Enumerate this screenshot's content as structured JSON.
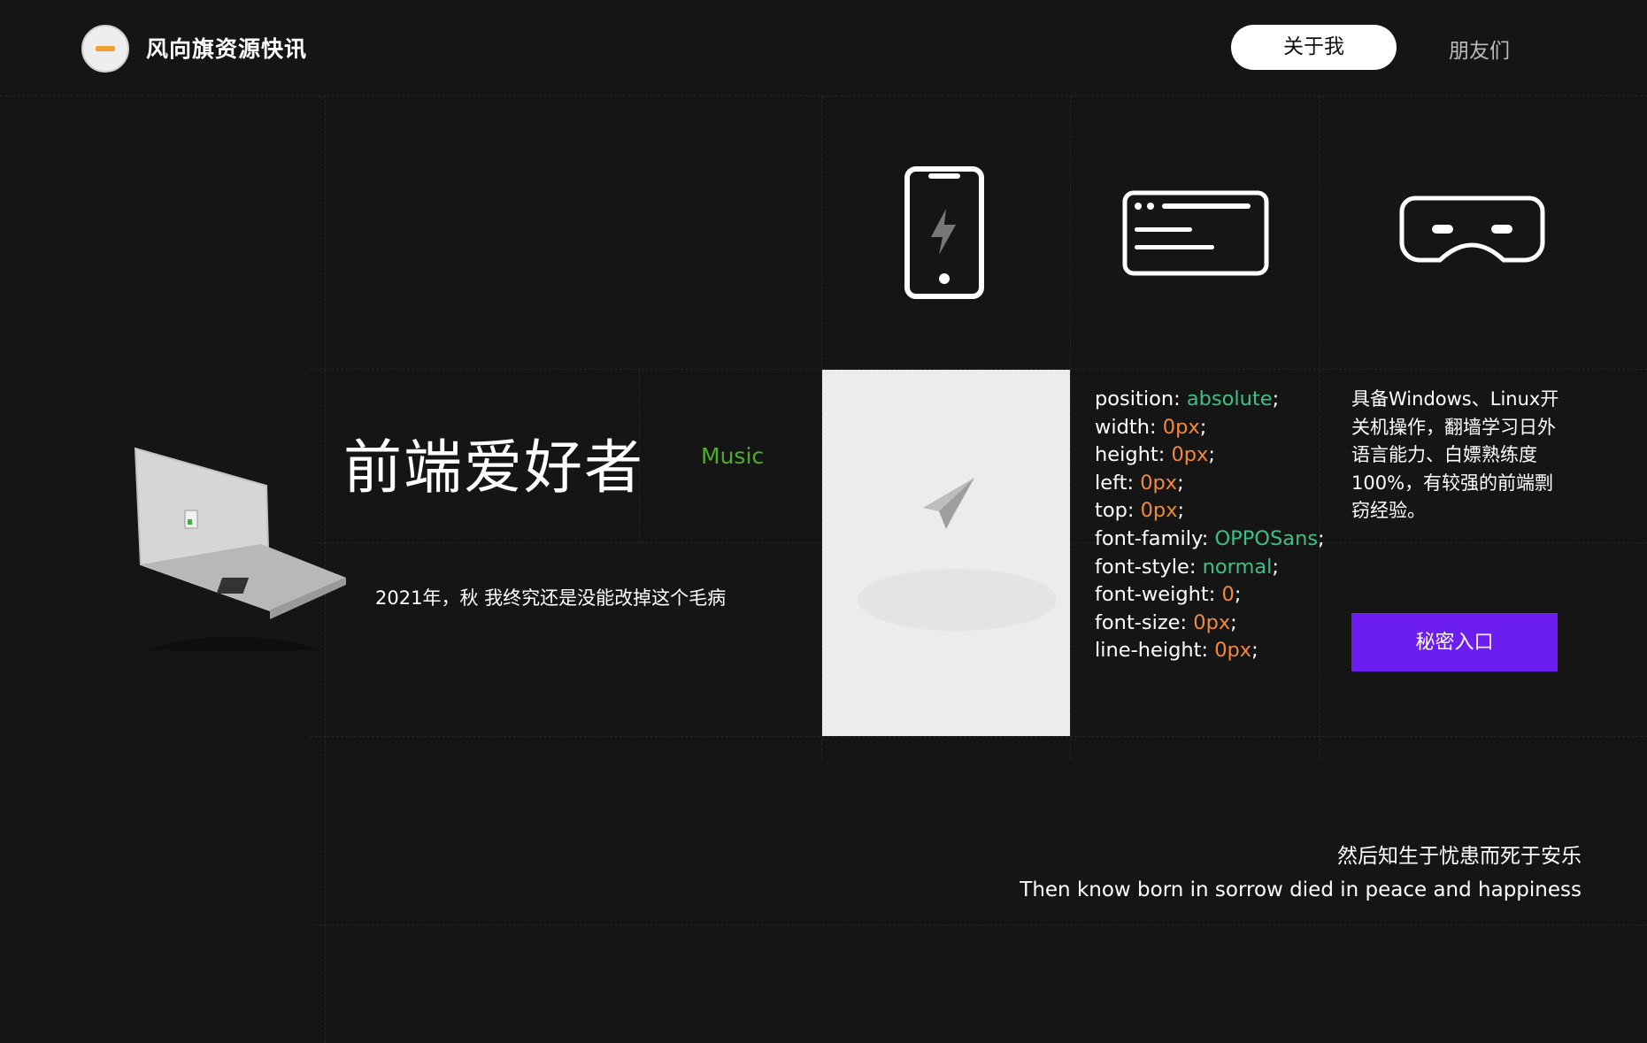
{
  "header": {
    "brand": "风向旗资源快讯",
    "nav": {
      "active": "关于我",
      "link": "朋友们"
    }
  },
  "hero": {
    "title": "前端爱好者",
    "tag": "Music",
    "subtitle": "2021年，秋 我终究还是没能改掉这个毛病"
  },
  "icons": [
    "phone-flash-icon",
    "browser-window-icon",
    "vr-headset-icon",
    "paper-plane-icon",
    "laptop-illustration"
  ],
  "code": {
    "lines": [
      {
        "prop": "position",
        "value": "absolute",
        "color": "green"
      },
      {
        "prop": "width",
        "value": "0px",
        "color": "orange"
      },
      {
        "prop": "height",
        "value": "0px",
        "color": "orange"
      },
      {
        "prop": "left",
        "value": "0px",
        "color": "orange"
      },
      {
        "prop": "top",
        "value": "0px",
        "color": "orange"
      },
      {
        "prop": "font-family",
        "value": "OPPOSans",
        "color": "green"
      },
      {
        "prop": "font-style",
        "value": "normal",
        "color": "green"
      },
      {
        "prop": "font-weight",
        "value": "0",
        "color": "orange"
      },
      {
        "prop": "font-size",
        "value": "0px",
        "color": "orange"
      },
      {
        "prop": "line-height",
        "value": "0px",
        "color": "orange"
      }
    ]
  },
  "about": {
    "text": "具备Windows、Linux开关机操作，翻墙学习日外语言能力、白嫖熟练度100%，有较强的前端剽窃经验。",
    "button": "秘密入口"
  },
  "quote": {
    "cn": "然后知生于忧患而死于安乐",
    "en": "Then know born in sorrow died in peace and happiness"
  },
  "colors": {
    "background": "#151515",
    "accent": "#6c1ef0",
    "green": "#3fbf86",
    "orange": "#f08a3c",
    "music": "#4dab2f"
  }
}
